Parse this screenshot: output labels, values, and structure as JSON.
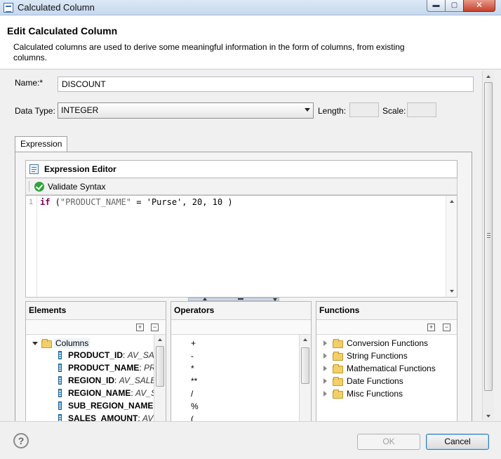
{
  "window": {
    "title": "Calculated Column",
    "min_glyph": "▬",
    "max_glyph": "▢",
    "close_glyph": "✕"
  },
  "header": {
    "title": "Edit Calculated Column",
    "description": "Calculated columns are used to derive some meaningful information in the form of columns, from existing columns."
  },
  "form": {
    "name_label": "Name:*",
    "name_value": "DISCOUNT",
    "data_type_label": "Data Type:",
    "data_type_value": "INTEGER",
    "length_label": "Length:",
    "length_value": "",
    "scale_label": "Scale:",
    "scale_value": ""
  },
  "tabs": [
    {
      "label": "Expression",
      "selected": true
    }
  ],
  "editor": {
    "title": "Expression Editor",
    "validate_label": "Validate Syntax",
    "line_number": "1",
    "code": {
      "keyword": "if",
      "open": " (",
      "column": "\"PRODUCT_NAME\"",
      "middle": " = 'Purse', 20, 10 )"
    }
  },
  "elements": {
    "header": "Elements",
    "root_label": "Columns",
    "items": [
      {
        "name": "PRODUCT_ID",
        "source": "AV_SAL"
      },
      {
        "name": "PRODUCT_NAME",
        "source": "PRO"
      },
      {
        "name": "REGION_ID",
        "source": "AV_SALES"
      },
      {
        "name": "REGION_NAME",
        "source": "AV_SA"
      },
      {
        "name": "SUB_REGION_NAME",
        "source": "."
      },
      {
        "name": "SALES_AMOUNT",
        "source": "AV"
      }
    ]
  },
  "operators": {
    "header": "Operators",
    "items": [
      "+",
      "-",
      "*",
      "**",
      "/",
      "%",
      "("
    ]
  },
  "functions": {
    "header": "Functions",
    "items": [
      "Conversion Functions",
      "String Functions",
      "Mathematical Functions",
      "Date Functions",
      "Misc Functions"
    ]
  },
  "footer": {
    "help_glyph": "?",
    "ok_label": "OK",
    "cancel_label": "Cancel"
  }
}
